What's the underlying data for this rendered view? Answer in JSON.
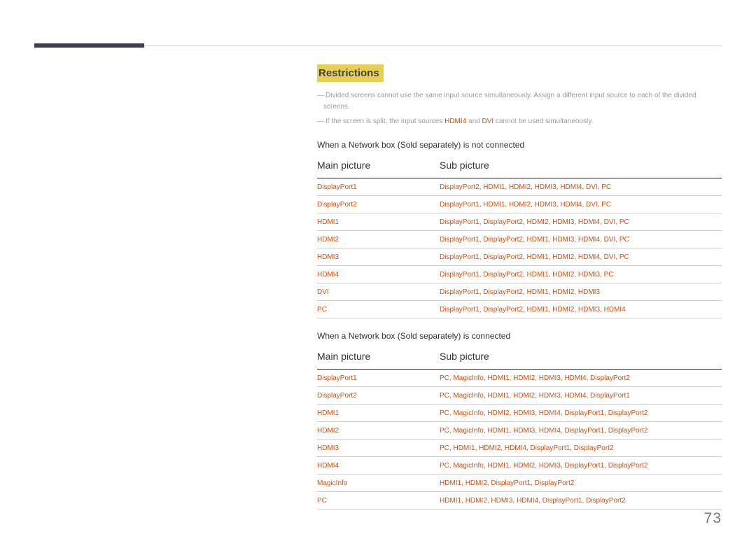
{
  "page_number": "73",
  "section_title": "Restrictions",
  "notes": [
    {
      "pre": "Divided screens cannot use the same input source simultaneously. Assign a different input source to each of the divided screens."
    },
    {
      "pre": "If the screen is split, the input sources ",
      "accent1": "HDMI4",
      "mid": " and ",
      "accent2": "DVI",
      "post": " cannot be used simultaneously."
    }
  ],
  "tables": [
    {
      "subhead": "When a Network box (Sold separately) is not connected",
      "col_main": "Main picture",
      "col_sub": "Sub picture",
      "rows": [
        {
          "main": "DisplayPort1",
          "sub": [
            "DisplayPort2",
            "HDMI1",
            "HDMI2",
            "HDMI3",
            "HDMI4",
            "DVI",
            "PC"
          ]
        },
        {
          "main": "DisplayPort2",
          "sub": [
            "DisplayPort1",
            "HDMI1",
            "HDMI2",
            "HDMI3",
            "HDMI4",
            "DVI",
            "PC"
          ]
        },
        {
          "main": "HDMI1",
          "sub": [
            "DisplayPort1",
            "DisplayPort2",
            "HDMI2",
            "HDMI3",
            "HDMI4",
            "DVI",
            "PC"
          ]
        },
        {
          "main": "HDMI2",
          "sub": [
            "DisplayPort1",
            "DisplayPort2",
            "HDMI1",
            "HDMI3",
            "HDMI4",
            "DVI",
            "PC"
          ]
        },
        {
          "main": "HDMI3",
          "sub": [
            "DisplayPort1",
            "DisplayPort2",
            "HDMI1",
            "HDMI2",
            "HDMI4",
            "DVI",
            "PC"
          ]
        },
        {
          "main": "HDMI4",
          "sub": [
            "DisplayPort1",
            "DisplayPort2",
            "HDMI1",
            "HDMI2",
            "HDMI3",
            "PC"
          ]
        },
        {
          "main": "DVI",
          "sub": [
            "DisplayPort1",
            "DisplayPort2",
            "HDMI1",
            "HDMI2",
            "HDMI3"
          ]
        },
        {
          "main": "PC",
          "sub": [
            "DisplayPort1",
            "DisplayPort2",
            "HDMI1",
            "HDMI2",
            "HDMI3",
            "HDMI4"
          ]
        }
      ]
    },
    {
      "subhead": "When a Network box (Sold separately) is connected",
      "col_main": "Main picture",
      "col_sub": "Sub picture",
      "rows": [
        {
          "main": "DisplayPort1",
          "sub": [
            "PC",
            "MagicInfo",
            "HDMI1",
            "HDMI2",
            "HDMI3",
            "HDMI4",
            "DisplayPort2"
          ]
        },
        {
          "main": "DisplayPort2",
          "sub": [
            "PC",
            "MagicInfo",
            "HDMI1",
            "HDMI2",
            "HDMI3",
            "HDMI4",
            "DisplayPort1"
          ]
        },
        {
          "main": "HDMI1",
          "sub": [
            "PC",
            "MagicInfo",
            "HDMI2",
            "HDMI3",
            "HDMI4",
            "DisplayPort1",
            "DisplayPort2"
          ]
        },
        {
          "main": "HDMI2",
          "sub": [
            "PC",
            "MagicInfo",
            "HDMI1",
            "HDMI3",
            "HDMI4",
            "DisplayPort1",
            "DisplayPort2"
          ]
        },
        {
          "main": "HDMI3",
          "sub": [
            "PC",
            "HDMI1",
            "HDMI2",
            "HDMI4",
            "DisplayPort1",
            "DisplayPort2"
          ]
        },
        {
          "main": "HDMI4",
          "sub": [
            "PC",
            "MagicInfo",
            "HDMI1",
            "HDMI2",
            "HDMI3",
            "DisplayPort1",
            "DisplayPort2"
          ]
        },
        {
          "main": "MagicInfo",
          "sub": [
            "HDMI1",
            "HDMI2",
            "DisplayPort1",
            "DisplayPort2"
          ]
        },
        {
          "main": "PC",
          "sub": [
            "HDMI1",
            "HDMI2",
            "HDMI3",
            "HDMI4",
            "DisplayPort1",
            "DisplayPort2"
          ]
        }
      ]
    }
  ]
}
